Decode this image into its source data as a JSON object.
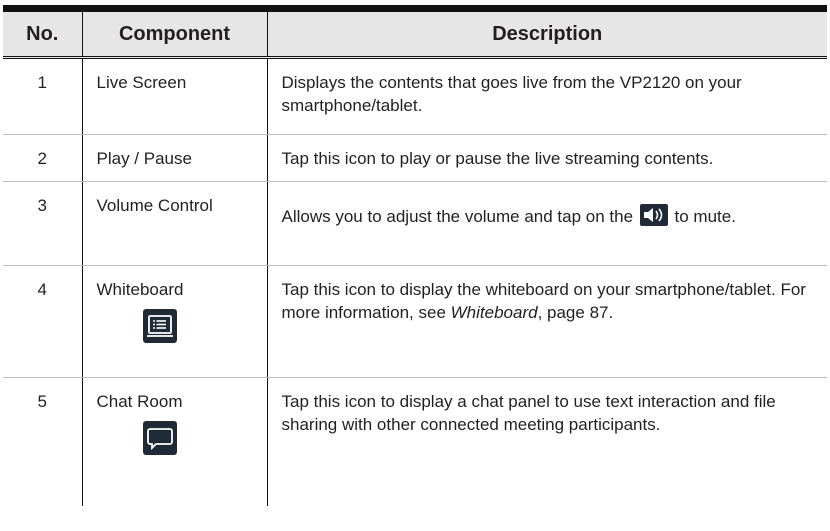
{
  "table": {
    "headers": [
      "No.",
      "Component",
      "Description"
    ],
    "rows": [
      {
        "no": "1",
        "component": "Live Screen",
        "description": "Displays the contents that goes live from the VP2120 on your smartphone/tablet."
      },
      {
        "no": "2",
        "component": "Play / Pause",
        "description": "Tap this icon to play or pause the live streaming contents."
      },
      {
        "no": "3",
        "component": "Volume Control",
        "description_pre": "Allows you to adjust the volume and tap on the",
        "description_post": "to mute.",
        "icon": "speaker-icon"
      },
      {
        "no": "4",
        "component": "Whiteboard",
        "description_pre": "Tap this icon to display the whiteboard on your smartphone/tablet. For more information, see",
        "link_italic": "Whiteboard",
        "description_post": ", page 87.",
        "icon": "whiteboard-icon"
      },
      {
        "no": "5",
        "component": "Chat Room",
        "description": "Tap this icon to display a chat panel to use text interaction and file sharing with other connected meeting participants.",
        "icon": "chat-icon"
      }
    ]
  }
}
